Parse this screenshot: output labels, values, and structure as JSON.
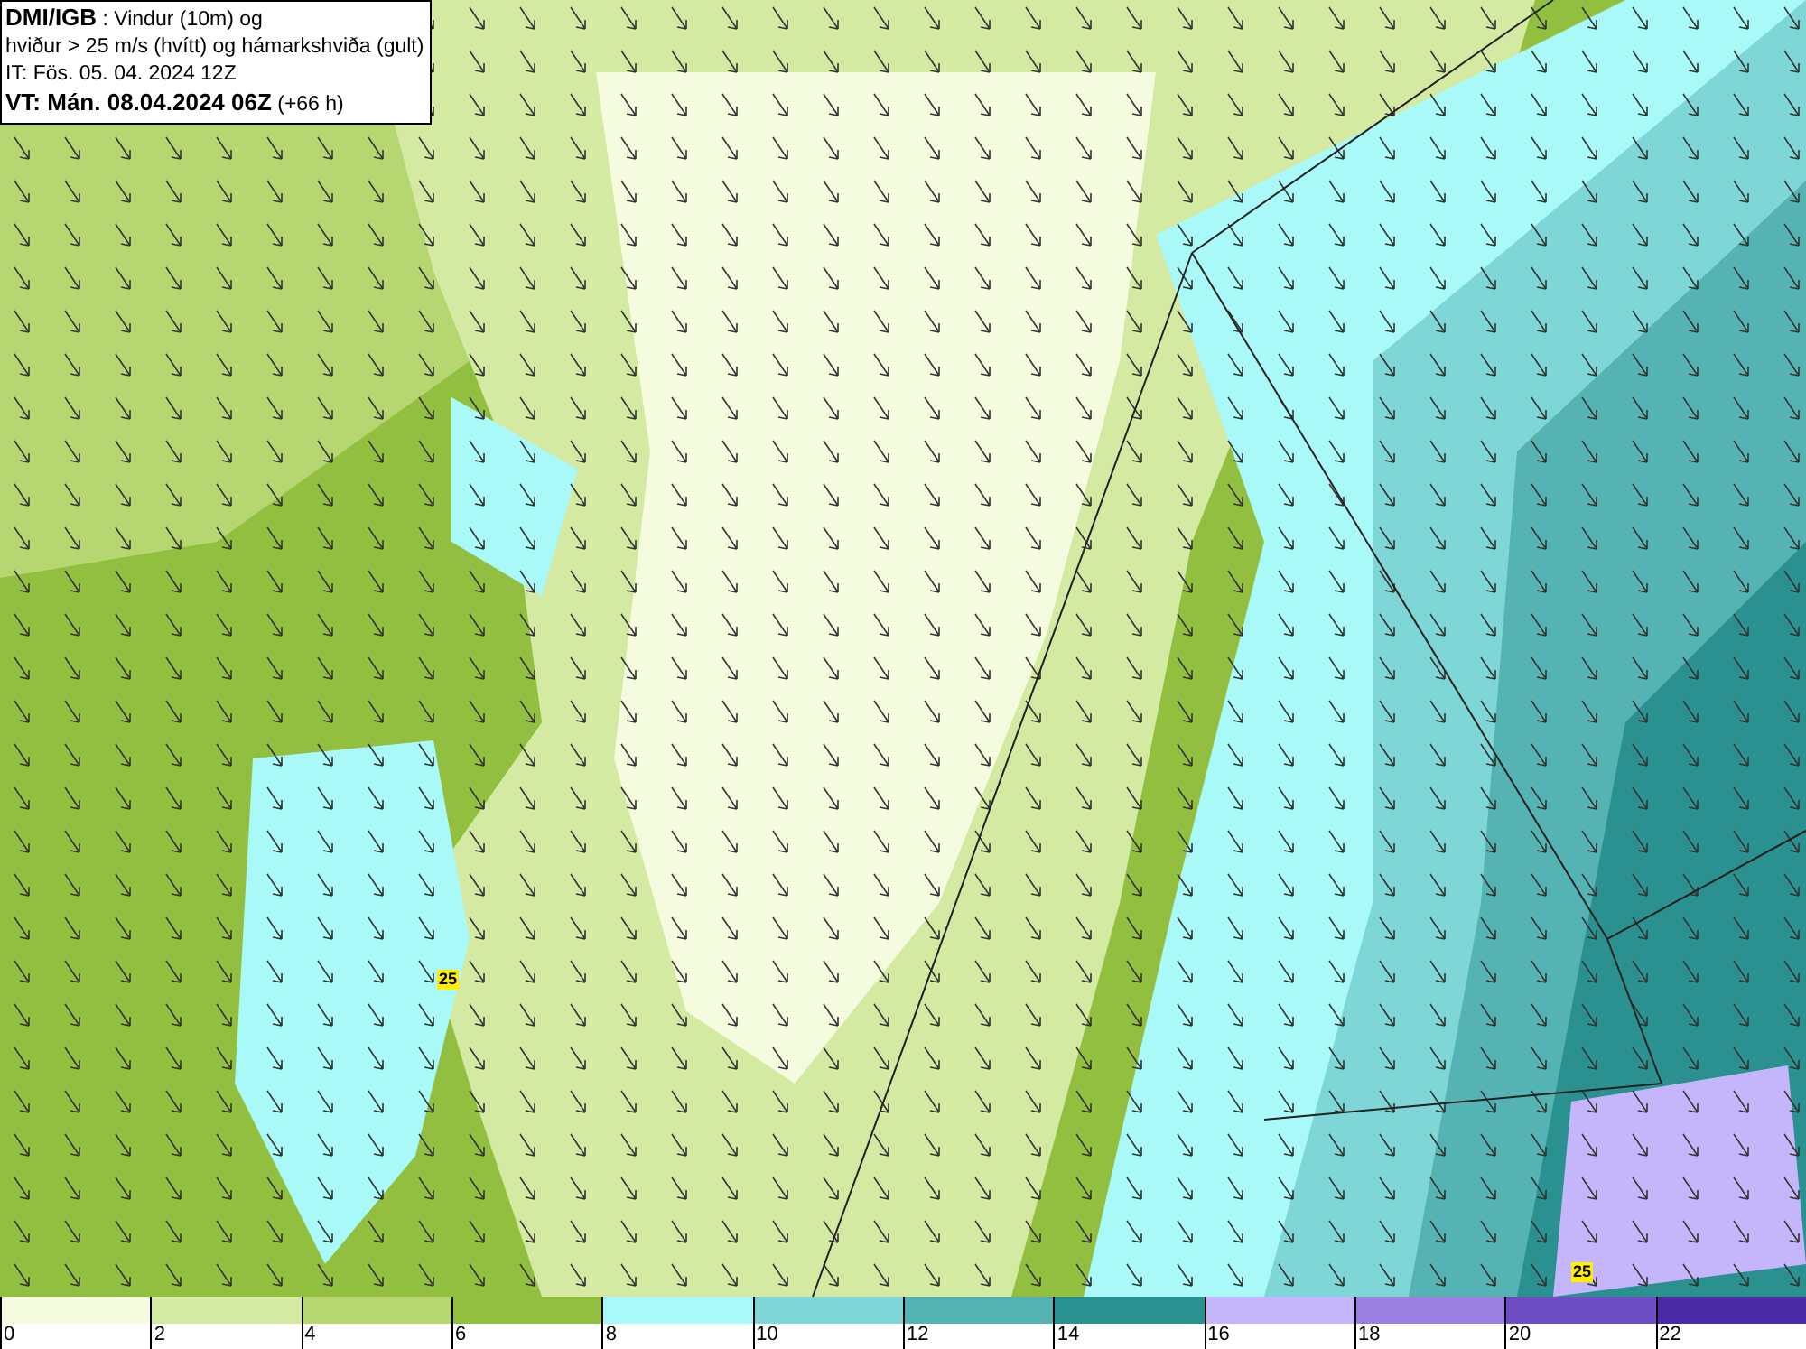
{
  "header": {
    "source": "DMI/IGB",
    "title_rest": " : Vindur (10m) og",
    "line2": "hviður > 25 m/s (hvítt) og hámarkshviða (gult)",
    "issue_time": "IT: Fös. 05. 04. 2024 12Z",
    "valid_time": "VT: Mán. 08.04.2024 06Z",
    "lead": " (+66 h)"
  },
  "gust_markers": [
    {
      "value": "25"
    },
    {
      "value": "25"
    }
  ],
  "legend": [
    {
      "label": "0",
      "color": "#f5fbdf"
    },
    {
      "label": "2",
      "color": "#d4e9a2"
    },
    {
      "label": "4",
      "color": "#b5d671"
    },
    {
      "label": "6",
      "color": "#92bf40"
    },
    {
      "label": "8",
      "color": "#aaf9f9"
    },
    {
      "label": "10",
      "color": "#7fd6d6"
    },
    {
      "label": "12",
      "color": "#55b3b3"
    },
    {
      "label": "14",
      "color": "#2a9090"
    },
    {
      "label": "16",
      "color": "#c5b5fb"
    },
    {
      "label": "18",
      "color": "#9a80e0"
    },
    {
      "label": "20",
      "color": "#6d4ec2"
    },
    {
      "label": "22",
      "color": "#4a2aa5"
    }
  ]
}
